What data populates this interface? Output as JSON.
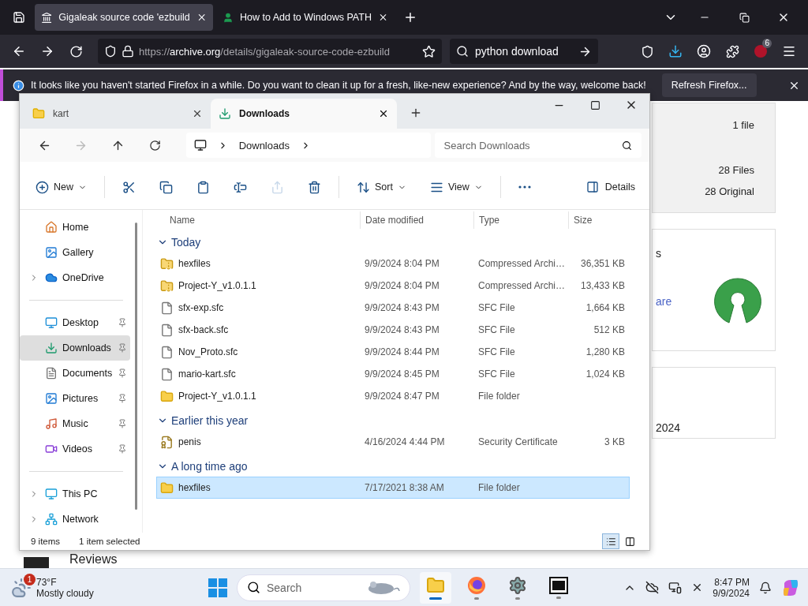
{
  "browser": {
    "tabs": [
      {
        "title": "Gigaleak source code 'ezbuild",
        "kind": "archive",
        "selected": true
      },
      {
        "title": "How to Add to Windows PATH",
        "kind": "person",
        "selected": false
      }
    ],
    "url": {
      "scheme": "https://",
      "host": "archive.org",
      "path": "/details/gigaleak-source-code-ezbuild"
    },
    "search": {
      "value": "python download"
    },
    "extensions_badge": "6",
    "notification": {
      "message": "It looks like you haven't started Firefox in a while. Do you want to clean it up for a fresh, like-new experience? And by the way, welcome back!",
      "button": "Refresh Firefox..."
    }
  },
  "webpage": {
    "stats": [
      "1 file",
      "28 Files",
      "28 Original"
    ],
    "fragment": "s",
    "link": "are",
    "date": "2024",
    "heading": "Reviews"
  },
  "explorer": {
    "tabs": [
      {
        "title": "kart",
        "kind": "folder",
        "selected": false
      },
      {
        "title": "Downloads",
        "kind": "download",
        "selected": true
      }
    ],
    "nav": {
      "forward_disabled": true
    },
    "breadcrumb": [
      "Downloads"
    ],
    "search": {
      "placeholder": "Search Downloads"
    },
    "commands": [
      {
        "kind": "new",
        "label": "New",
        "disabled": false
      },
      {
        "kind": "cut",
        "disabled": false
      },
      {
        "kind": "copy",
        "disabled": false
      },
      {
        "kind": "paste",
        "disabled": false
      },
      {
        "kind": "rename",
        "disabled": false
      },
      {
        "kind": "share",
        "disabled": true
      },
      {
        "kind": "delete",
        "disabled": false
      },
      {
        "kind": "sort",
        "label": "Sort",
        "disabled": false
      },
      {
        "kind": "view",
        "label": "View",
        "disabled": false
      },
      {
        "kind": "more",
        "disabled": false
      }
    ],
    "details_button": "Details",
    "sidebar": [
      [
        {
          "label": "Home",
          "kind": "home",
          "expandable": false,
          "pinned": false,
          "selected": false
        },
        {
          "label": "Gallery",
          "kind": "gallery",
          "expandable": false,
          "pinned": false,
          "selected": false
        },
        {
          "label": "OneDrive",
          "kind": "cloud",
          "expandable": true,
          "pinned": false,
          "selected": false
        }
      ],
      [
        {
          "label": "Desktop",
          "kind": "desktop",
          "expandable": false,
          "pinned": true,
          "selected": false
        },
        {
          "label": "Downloads",
          "kind": "download",
          "expandable": false,
          "pinned": true,
          "selected": true
        },
        {
          "label": "Documents",
          "kind": "documents",
          "expandable": false,
          "pinned": true,
          "selected": false
        },
        {
          "label": "Pictures",
          "kind": "pictures",
          "expandable": false,
          "pinned": true,
          "selected": false
        },
        {
          "label": "Music",
          "kind": "music",
          "expandable": false,
          "pinned": true,
          "selected": false
        },
        {
          "label": "Videos",
          "kind": "videos",
          "expandable": false,
          "pinned": true,
          "selected": false
        }
      ],
      [
        {
          "label": "This PC",
          "kind": "pc",
          "expandable": true,
          "pinned": false,
          "selected": false
        },
        {
          "label": "Network",
          "kind": "network",
          "expandable": true,
          "pinned": false,
          "selected": false
        }
      ]
    ],
    "columns": [
      "Name",
      "Date modified",
      "Type",
      "Size"
    ],
    "groups": [
      {
        "title": "Today",
        "expanded": true,
        "items": [
          {
            "name": "hexfiles",
            "date": "9/9/2024 8:04 PM",
            "type": "Compressed Archi…",
            "size": "36,351 KB",
            "kind": "archive",
            "selected": false
          },
          {
            "name": "Project-Y_v1.0.1.1",
            "date": "9/9/2024 8:04 PM",
            "type": "Compressed Archi…",
            "size": "13,433 KB",
            "kind": "archive",
            "selected": false
          },
          {
            "name": "sfx-exp.sfc",
            "date": "9/9/2024 8:43 PM",
            "type": "SFC File",
            "size": "1,664 KB",
            "kind": "file",
            "selected": false
          },
          {
            "name": "sfx-back.sfc",
            "date": "9/9/2024 8:43 PM",
            "type": "SFC File",
            "size": "512 KB",
            "kind": "file",
            "selected": false
          },
          {
            "name": "Nov_Proto.sfc",
            "date": "9/9/2024 8:44 PM",
            "type": "SFC File",
            "size": "1,280 KB",
            "kind": "file",
            "selected": false
          },
          {
            "name": "mario-kart.sfc",
            "date": "9/9/2024 8:45 PM",
            "type": "SFC File",
            "size": "1,024 KB",
            "kind": "file",
            "selected": false
          },
          {
            "name": "Project-Y_v1.0.1.1",
            "date": "9/9/2024 8:47 PM",
            "type": "File folder",
            "kind": "folder",
            "selected": false
          }
        ]
      },
      {
        "title": "Earlier this year",
        "expanded": true,
        "items": [
          {
            "name": "penis",
            "date": "4/16/2024 4:44 PM",
            "type": "Security Certificate",
            "size": "3 KB",
            "kind": "certificate",
            "selected": false
          }
        ]
      },
      {
        "title": "A long time ago",
        "expanded": true,
        "items": [
          {
            "name": "hexfiles",
            "date": "7/17/2021 8:38 AM",
            "type": "File folder",
            "kind": "folder",
            "selected": true
          }
        ]
      }
    ],
    "status": {
      "count": "9 items",
      "selection": "1 item selected"
    },
    "view_modes": [
      {
        "kind": "details",
        "selected": true
      },
      {
        "kind": "tiles",
        "selected": false
      }
    ]
  },
  "taskbar": {
    "weather": {
      "badge": "1",
      "temperature": "73°F",
      "condition": "Mostly cloudy"
    },
    "search": {
      "placeholder": "Search"
    },
    "apps": [
      {
        "kind": "explorer",
        "running": true,
        "active": true
      },
      {
        "kind": "firefox",
        "running": true,
        "active": false
      },
      {
        "kind": "settings",
        "running": true,
        "active": false
      },
      {
        "kind": "sevenzip",
        "running": true,
        "active": false
      }
    ],
    "time": "8:47 PM",
    "date": "9/9/2024"
  }
}
